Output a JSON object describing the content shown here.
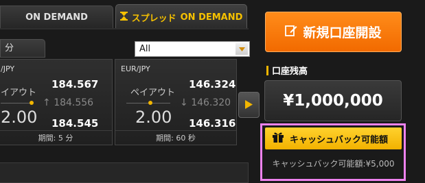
{
  "tabs": {
    "on_demand": "ON DEMAND",
    "spread_prefix": "スプレッド",
    "spread_suffix": "ON DEMAND"
  },
  "controls": {
    "period_value": "分",
    "select_value": "All"
  },
  "panels": [
    {
      "pair": "/JPY",
      "bid_label": "イアウト",
      "big_value": "2.00",
      "high": "184.567",
      "mid": "184.556",
      "mid_direction": "up",
      "low": "184.545",
      "footer": "期間: 5 分"
    },
    {
      "pair": "EUR/JPY",
      "bid_label": "ペイアウト",
      "big_value": "2.00",
      "high": "146.324",
      "mid": "146.320",
      "mid_direction": "down",
      "low": "146.316",
      "footer": "期間: 60 秒"
    }
  ],
  "account": {
    "open_button": "新規口座開設",
    "balance_label": "口座残高",
    "balance_value": "¥1,000,000",
    "cashback_title": "キャッシュバック可能額",
    "cashback_text": "キャッシュバック可能額:¥5,000"
  },
  "icons": {
    "up_arrow": "↑",
    "down_arrow": "↓"
  },
  "colors": {
    "accent_gold": "#f2b600",
    "orange_button": "#f57a00",
    "highlight_frame": "#ee82ee"
  }
}
